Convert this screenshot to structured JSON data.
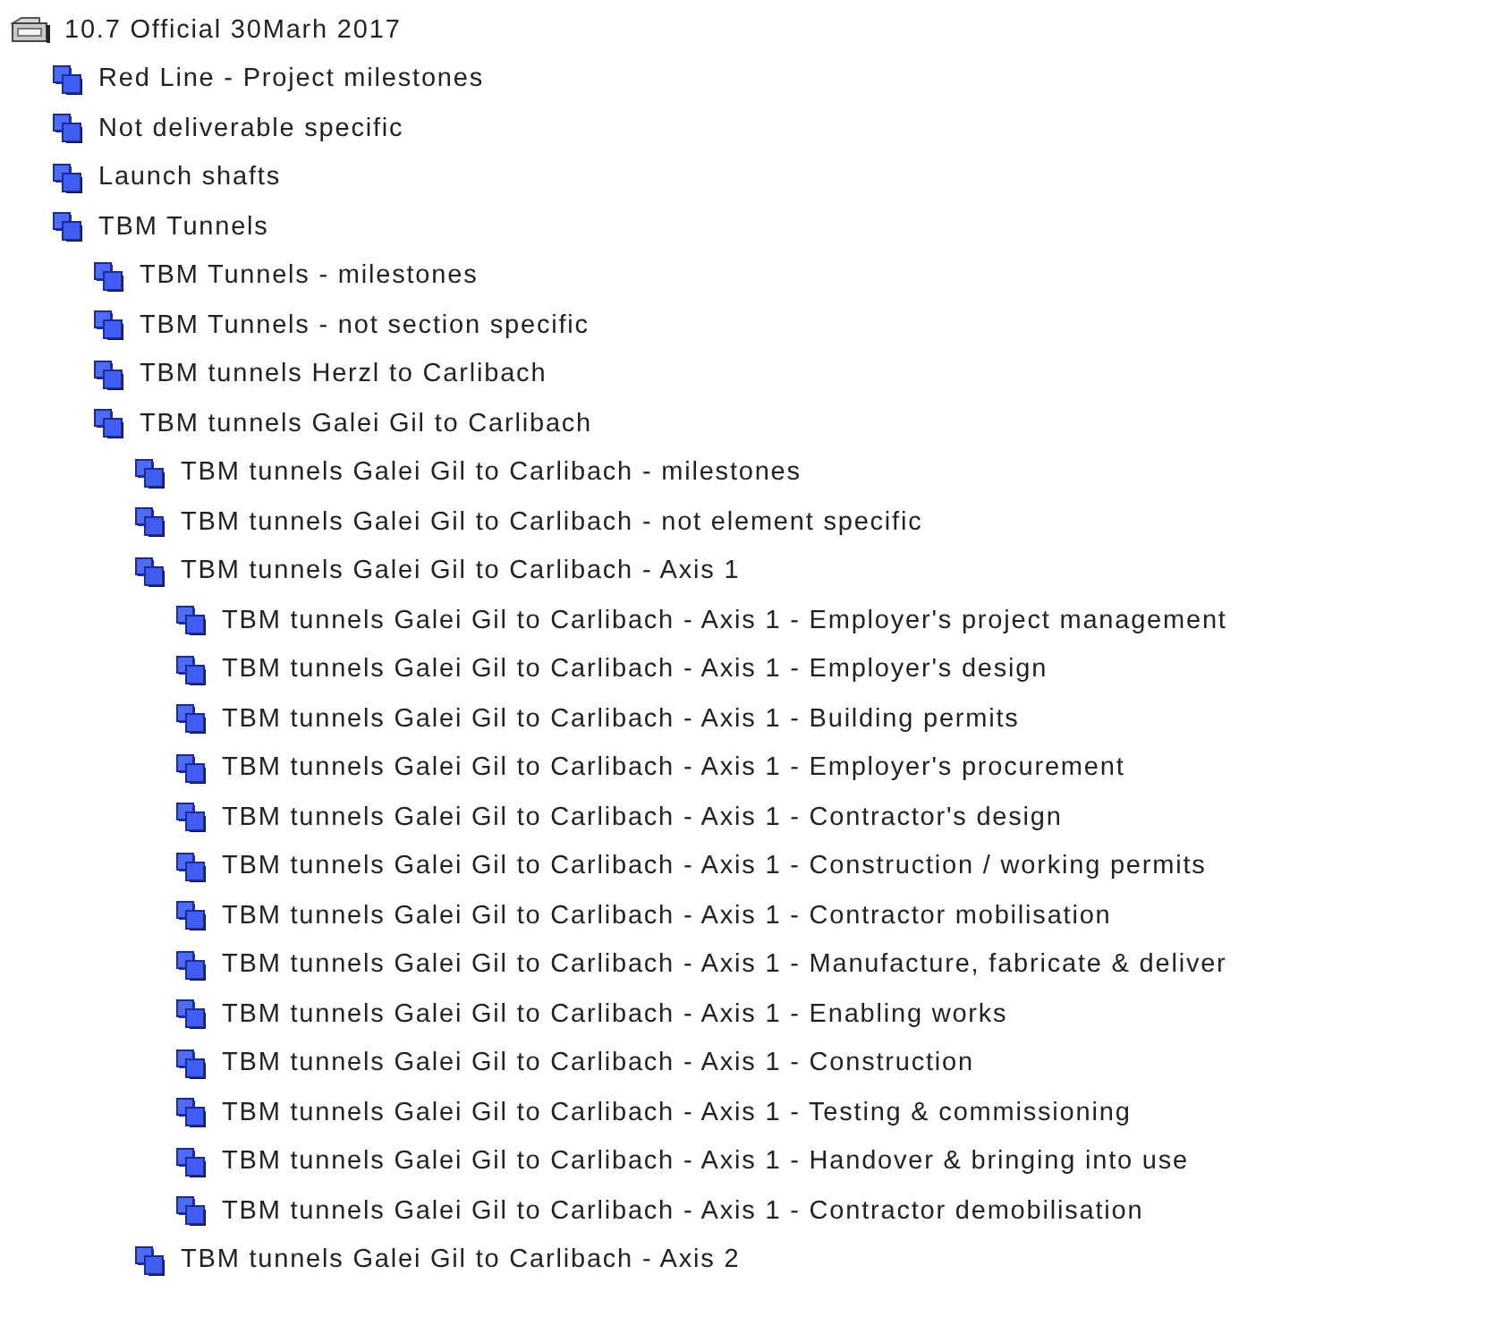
{
  "tree": [
    {
      "label": "10.7 Official 30Marh 2017",
      "kind": "root",
      "children": [
        {
          "label": "Red Line - Project milestones",
          "kind": "group"
        },
        {
          "label": "Not deliverable specific",
          "kind": "group"
        },
        {
          "label": "Launch shafts",
          "kind": "group"
        },
        {
          "label": "TBM Tunnels",
          "kind": "group",
          "children": [
            {
              "label": "TBM Tunnels - milestones",
              "kind": "group"
            },
            {
              "label": "TBM Tunnels - not section specific",
              "kind": "group"
            },
            {
              "label": "TBM tunnels Herzl to Carlibach",
              "kind": "group"
            },
            {
              "label": "TBM tunnels Galei Gil to Carlibach",
              "kind": "group",
              "children": [
                {
                  "label": "TBM tunnels Galei Gil to Carlibach - milestones",
                  "kind": "group"
                },
                {
                  "label": "TBM tunnels Galei Gil to Carlibach - not element specific",
                  "kind": "group"
                },
                {
                  "label": "TBM tunnels Galei Gil to Carlibach - Axis 1",
                  "kind": "group",
                  "children": [
                    {
                      "label": "TBM tunnels Galei Gil to Carlibach - Axis 1 - Employer's project management",
                      "kind": "group"
                    },
                    {
                      "label": "TBM tunnels Galei Gil to Carlibach - Axis 1 - Employer's design",
                      "kind": "group"
                    },
                    {
                      "label": "TBM tunnels Galei Gil to Carlibach - Axis 1 - Building permits",
                      "kind": "group"
                    },
                    {
                      "label": "TBM tunnels Galei Gil to Carlibach - Axis 1 - Employer's procurement",
                      "kind": "group"
                    },
                    {
                      "label": "TBM tunnels Galei Gil to Carlibach - Axis 1 - Contractor's design",
                      "kind": "group"
                    },
                    {
                      "label": "TBM tunnels Galei Gil to Carlibach - Axis 1 - Construction / working permits",
                      "kind": "group"
                    },
                    {
                      "label": "TBM tunnels Galei Gil to Carlibach - Axis 1 - Contractor mobilisation",
                      "kind": "group"
                    },
                    {
                      "label": "TBM tunnels Galei Gil to Carlibach - Axis 1 - Manufacture, fabricate & deliver",
                      "kind": "group"
                    },
                    {
                      "label": "TBM tunnels Galei Gil to Carlibach - Axis 1 - Enabling works",
                      "kind": "group"
                    },
                    {
                      "label": "TBM tunnels Galei Gil to Carlibach - Axis 1 - Construction",
                      "kind": "group"
                    },
                    {
                      "label": "TBM tunnels Galei Gil to Carlibach - Axis 1 - Testing & commissioning",
                      "kind": "group"
                    },
                    {
                      "label": "TBM tunnels Galei Gil to Carlibach - Axis 1 - Handover & bringing into use",
                      "kind": "group"
                    },
                    {
                      "label": "TBM tunnels Galei Gil to Carlibach - Axis 1 - Contractor demobilisation",
                      "kind": "group"
                    }
                  ]
                },
                {
                  "label": "TBM tunnels Galei Gil to Carlibach - Axis 2",
                  "kind": "group"
                }
              ]
            }
          ]
        }
      ]
    }
  ]
}
